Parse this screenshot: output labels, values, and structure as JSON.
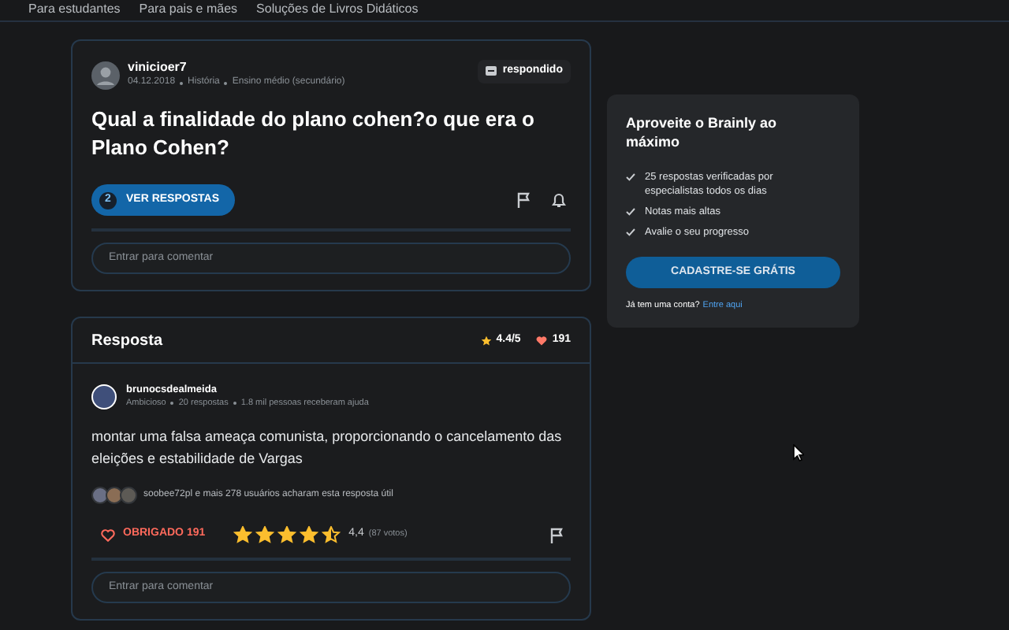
{
  "top_nav": [
    "Para estudantes",
    "Para pais e mães",
    "Soluções de Livros Didáticos"
  ],
  "question": {
    "author": "vinicioer7",
    "date": "04.12.2018",
    "subject": "História",
    "level": "Ensino médio (secundário)",
    "badge": "respondido",
    "text": "Qual a finalidade do plano cohen?o que era o Plano Cohen?",
    "answers_count": "2",
    "answers_button": "VER RESPOSTAS",
    "comment_placeholder": "Entrar para comentar"
  },
  "promo": {
    "title": "Aproveite o Brainly ao máximo",
    "benefits": [
      "25 respostas verificadas por especialistas todos os dias",
      "Notas mais altas",
      "Avalie o seu progresso"
    ],
    "button": "CADASTRE-SE GRÁTIS",
    "login_text": "Já tem uma conta?",
    "login_link": "Entre aqui"
  },
  "answer": {
    "heading": "Resposta",
    "rating": "4.4/5",
    "likes": "191",
    "author": "brunocsdealmeida",
    "rank": "Ambicioso",
    "answers": "20 respostas",
    "helped": "1.8 mil pessoas receberam ajuda",
    "text": "montar uma falsa ameaça comunista, proporcionando o cancelamento das eleições e estabilidade de Vargas",
    "useful": "soobee72pl e mais 278 usuários acharam esta resposta útil",
    "thanks": "OBRIGADO 191",
    "stars": 4.5,
    "score": "4,4",
    "votes": "(87 votos)",
    "comment_placeholder": "Entrar para comentar"
  }
}
